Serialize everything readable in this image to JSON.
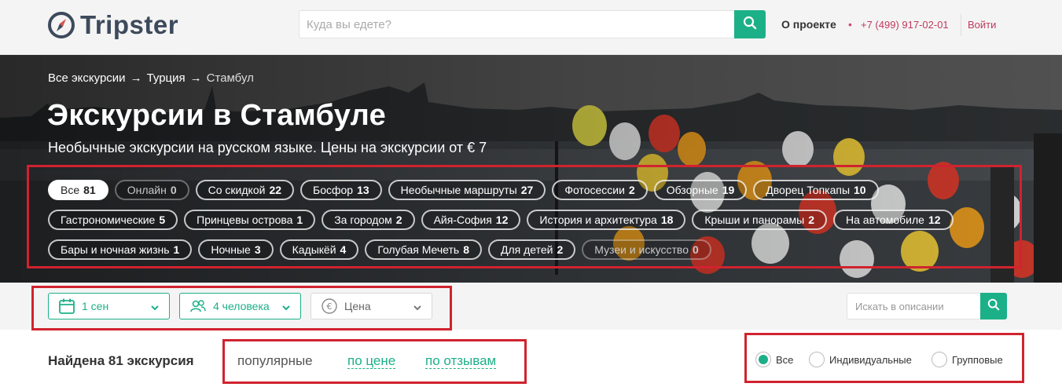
{
  "header": {
    "logo_text": "Tripster",
    "search_placeholder": "Куда вы едете?",
    "about_label": "О проекте",
    "phone": "+7 (499) 917-02-01",
    "login_label": "Войти"
  },
  "hero": {
    "breadcrumbs": [
      "Все экскурсии",
      "Турция",
      "Стамбул"
    ],
    "title": "Экскурсии в Стамбуле",
    "subtitle": "Необычные экскурсии на русском языке. Цены на экскурсии от € 7",
    "tag_rows": [
      [
        {
          "label": "Все",
          "count": "81",
          "state": "active"
        },
        {
          "label": "Онлайн",
          "count": "0",
          "state": "disabled"
        },
        {
          "label": "Со скидкой",
          "count": "22",
          "state": "normal"
        },
        {
          "label": "Босфор",
          "count": "13",
          "state": "normal"
        },
        {
          "label": "Необычные маршруты",
          "count": "27",
          "state": "normal"
        },
        {
          "label": "Фотосессии",
          "count": "2",
          "state": "normal"
        },
        {
          "label": "Обзорные",
          "count": "19",
          "state": "normal"
        },
        {
          "label": "Дворец Топкапы",
          "count": "10",
          "state": "normal"
        }
      ],
      [
        {
          "label": "Гастрономические",
          "count": "5",
          "state": "normal"
        },
        {
          "label": "Принцевы острова",
          "count": "1",
          "state": "normal"
        },
        {
          "label": "За городом",
          "count": "2",
          "state": "normal"
        },
        {
          "label": "Айя-София",
          "count": "12",
          "state": "normal"
        },
        {
          "label": "История и архитектура",
          "count": "18",
          "state": "normal"
        },
        {
          "label": "Крыши и панорамы",
          "count": "2",
          "state": "normal"
        },
        {
          "label": "На автомобиле",
          "count": "12",
          "state": "normal"
        }
      ],
      [
        {
          "label": "Бары и ночная жизнь",
          "count": "1",
          "state": "normal"
        },
        {
          "label": "Ночные",
          "count": "3",
          "state": "normal"
        },
        {
          "label": "Кадыкёй",
          "count": "4",
          "state": "normal"
        },
        {
          "label": "Голубая Мечеть",
          "count": "8",
          "state": "normal"
        },
        {
          "label": "Для детей",
          "count": "2",
          "state": "normal"
        },
        {
          "label": "Музеи и искусство",
          "count": "0",
          "state": "disabled"
        }
      ]
    ]
  },
  "filters": {
    "date": "1 сен",
    "people": "4 человека",
    "price": "Цена",
    "desc_search_placeholder": "Искать в описании"
  },
  "results": {
    "found_text": "Найдена 81 экскурсия",
    "sort": {
      "popular": "популярные",
      "by_price": "по цене",
      "by_reviews": "по отзывам"
    },
    "type_options": [
      {
        "label": "Все",
        "checked": true
      },
      {
        "label": "Индивидуальные",
        "checked": false
      },
      {
        "label": "Групповые",
        "checked": false
      }
    ]
  },
  "colors": {
    "accent": "#1cb088",
    "highlight_box": "#d0232f",
    "phone": "#c0395e"
  }
}
